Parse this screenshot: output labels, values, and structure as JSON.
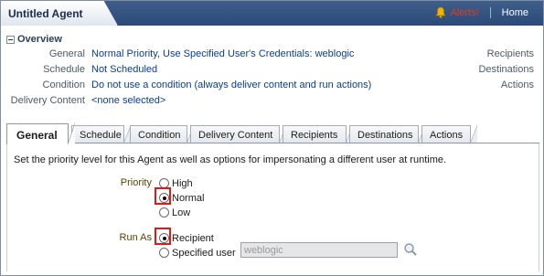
{
  "header": {
    "title": "Untitled Agent",
    "alerts_label": "Alerts!",
    "home_label": "Home"
  },
  "overview": {
    "title": "Overview",
    "rows": [
      {
        "label": "General",
        "value": "Normal Priority, Use Specified User's Credentials: weblogic"
      },
      {
        "label": "Schedule",
        "value": "Not Scheduled"
      },
      {
        "label": "Condition",
        "value": "Do not use a condition (always deliver content and run actions)"
      },
      {
        "label": "Delivery Content",
        "value": "<none selected>"
      }
    ],
    "right_labels": [
      "Recipients",
      "Destinations",
      "Actions"
    ]
  },
  "tabs": [
    {
      "label": "General",
      "active": true
    },
    {
      "label": "Schedule"
    },
    {
      "label": "Condition"
    },
    {
      "label": "Delivery Content"
    },
    {
      "label": "Recipients"
    },
    {
      "label": "Destinations"
    },
    {
      "label": "Actions"
    }
  ],
  "general": {
    "intro": "Set the priority level for this Agent as well as options for impersonating a different user at runtime.",
    "priority": {
      "label": "Priority",
      "options": [
        "High",
        "Normal",
        "Low"
      ],
      "selected": "Normal"
    },
    "run_as": {
      "label": "Run As",
      "options": [
        "Recipient",
        "Specified user"
      ],
      "selected": "Recipient",
      "user_value": "weblogic"
    }
  },
  "colors": {
    "header_bg": "#2f4f7f",
    "link": "#0a3d8f",
    "alert": "#e23b1b",
    "highlight": "#e01818"
  },
  "icons": {
    "alerts": "bell-icon",
    "overview_toggle": "collapse-icon",
    "user_search": "search-icon"
  }
}
